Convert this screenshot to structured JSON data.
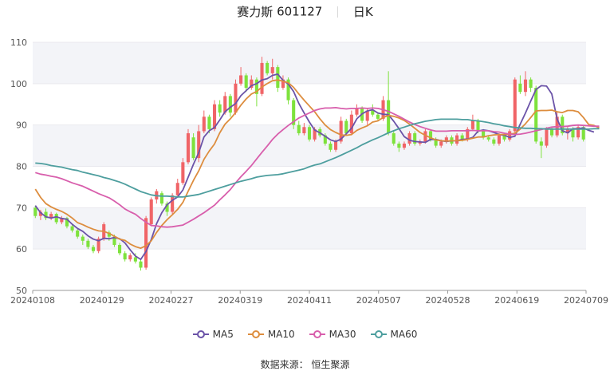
{
  "header": {
    "stock_name": "赛力斯",
    "stock_code": "601127",
    "period": "日K"
  },
  "source": {
    "label": "数据来源：",
    "value": "恒生聚源"
  },
  "colors": {
    "up": "#f06467",
    "down": "#7ee23c",
    "MA5": "#6b53a8",
    "MA10": "#dd8d3e",
    "MA30": "#d85eac",
    "MA60": "#4d9e9e"
  },
  "chart_data": {
    "type": "candlestick",
    "ylim": [
      50,
      110
    ],
    "yticks": [
      50,
      60,
      70,
      80,
      90,
      100,
      110
    ],
    "xticks": [
      "20240108",
      "20240129",
      "20240227",
      "20240319",
      "20240411",
      "20240507",
      "20240528",
      "20240619",
      "20240709"
    ],
    "grid": "banded-horizontal",
    "legend_position": "bottom-center",
    "candles": [
      [
        70.0,
        68.0,
        70.5,
        67.5
      ],
      [
        68.0,
        69.0,
        69.5,
        67.0
      ],
      [
        69.0,
        67.5,
        69.8,
        67.0
      ],
      [
        67.5,
        68.5,
        69.0,
        67.0
      ],
      [
        68.5,
        66.5,
        68.8,
        66.0
      ],
      [
        66.5,
        67.5,
        68.0,
        66.0
      ],
      [
        67.5,
        65.5,
        67.8,
        65.0
      ],
      [
        65.5,
        64.5,
        66.0,
        64.0
      ],
      [
        64.5,
        63.0,
        65.0,
        62.5
      ],
      [
        63.0,
        62.0,
        63.5,
        61.0
      ],
      [
        62.0,
        60.5,
        62.5,
        60.0
      ],
      [
        60.5,
        59.5,
        61.0,
        59.0
      ],
      [
        59.5,
        62.5,
        63.0,
        59.0
      ],
      [
        62.5,
        66.0,
        66.5,
        62.0
      ],
      [
        64.0,
        63.0,
        64.5,
        62.0
      ],
      [
        63.0,
        61.0,
        63.5,
        60.5
      ],
      [
        61.0,
        59.0,
        61.5,
        58.5
      ],
      [
        59.0,
        57.5,
        59.5,
        57.0
      ],
      [
        57.5,
        58.5,
        59.0,
        57.0
      ],
      [
        58.0,
        57.0,
        59.0,
        56.5
      ],
      [
        57.0,
        55.5,
        57.5,
        54.8
      ],
      [
        55.5,
        67.5,
        68.0,
        55.0
      ],
      [
        66.0,
        72.0,
        72.5,
        65.5
      ],
      [
        72.0,
        74.0,
        74.5,
        71.0
      ],
      [
        73.5,
        71.0,
        74.0,
        70.5
      ],
      [
        71.0,
        69.0,
        71.5,
        68.0
      ],
      [
        69.0,
        73.0,
        73.5,
        68.5
      ],
      [
        73.0,
        76.0,
        77.0,
        72.5
      ],
      [
        76.0,
        81.0,
        82.0,
        75.5
      ],
      [
        81.0,
        88.0,
        89.0,
        80.5
      ],
      [
        87.0,
        82.0,
        88.0,
        81.5
      ],
      [
        82.0,
        88.5,
        90.0,
        81.0
      ],
      [
        88.5,
        92.0,
        93.5,
        88.0
      ],
      [
        92.0,
        89.0,
        92.5,
        88.0
      ],
      [
        89.0,
        95.0,
        96.0,
        88.5
      ],
      [
        95.0,
        93.0,
        96.0,
        92.0
      ],
      [
        93.0,
        97.0,
        98.0,
        92.5
      ],
      [
        97.0,
        93.0,
        97.5,
        92.0
      ],
      [
        93.0,
        100.0,
        101.0,
        92.5
      ],
      [
        100.0,
        102.0,
        104.0,
        99.5
      ],
      [
        102.0,
        99.0,
        102.5,
        98.0
      ],
      [
        99.0,
        101.0,
        102.0,
        98.5
      ],
      [
        101.0,
        97.5,
        101.5,
        94.5
      ],
      [
        97.5,
        105.0,
        106.5,
        97.0
      ],
      [
        105.0,
        102.5,
        105.5,
        102.0
      ],
      [
        102.5,
        104.0,
        106.0,
        101.0
      ],
      [
        104.0,
        99.0,
        104.5,
        98.0
      ],
      [
        99.0,
        101.0,
        102.0,
        98.5
      ],
      [
        101.0,
        96.0,
        101.5,
        95.0
      ],
      [
        96.0,
        90.0,
        96.5,
        89.0
      ],
      [
        90.0,
        88.0,
        91.0,
        87.5
      ],
      [
        88.0,
        89.5,
        90.5,
        87.5
      ],
      [
        89.5,
        86.5,
        90.0,
        86.0
      ],
      [
        86.5,
        89.0,
        89.5,
        86.0
      ],
      [
        89.0,
        87.5,
        89.5,
        87.0
      ],
      [
        87.5,
        85.5,
        88.0,
        85.0
      ],
      [
        85.5,
        84.0,
        86.0,
        83.5
      ],
      [
        84.0,
        86.0,
        86.5,
        83.5
      ],
      [
        86.0,
        91.0,
        92.0,
        85.5
      ],
      [
        91.0,
        88.0,
        91.5,
        87.5
      ],
      [
        88.0,
        92.5,
        93.5,
        87.5
      ],
      [
        92.5,
        94.0,
        95.0,
        92.0
      ],
      [
        94.0,
        91.0,
        94.5,
        90.5
      ],
      [
        91.0,
        93.5,
        94.0,
        90.0
      ],
      [
        93.5,
        92.5,
        95.0,
        92.0
      ],
      [
        92.5,
        91.5,
        93.0,
        91.0
      ],
      [
        91.5,
        96.0,
        97.0,
        91.0
      ],
      [
        96.0,
        88.0,
        103.0,
        87.5
      ],
      [
        88.0,
        85.5,
        88.5,
        85.0
      ],
      [
        85.5,
        84.5,
        86.0,
        83.5
      ],
      [
        84.5,
        85.5,
        86.0,
        84.0
      ],
      [
        85.5,
        88.0,
        88.5,
        85.0
      ],
      [
        88.0,
        85.5,
        88.5,
        85.0
      ],
      [
        85.5,
        86.0,
        86.5,
        85.0
      ],
      [
        86.0,
        88.5,
        89.0,
        85.5
      ],
      [
        88.5,
        86.5,
        89.0,
        86.0
      ],
      [
        86.5,
        85.0,
        87.0,
        84.5
      ],
      [
        85.0,
        86.0,
        86.5,
        84.5
      ],
      [
        86.0,
        87.0,
        87.5,
        85.5
      ],
      [
        87.0,
        85.5,
        87.5,
        85.0
      ],
      [
        85.5,
        87.5,
        88.0,
        85.0
      ],
      [
        87.5,
        86.5,
        88.0,
        86.0
      ],
      [
        86.5,
        89.0,
        89.5,
        86.0
      ],
      [
        89.0,
        91.0,
        92.5,
        88.5
      ],
      [
        91.0,
        88.5,
        91.5,
        88.0
      ],
      [
        88.5,
        87.0,
        89.0,
        86.5
      ],
      [
        87.0,
        86.5,
        87.5,
        86.0
      ],
      [
        86.5,
        85.5,
        87.0,
        85.0
      ],
      [
        85.5,
        87.5,
        88.0,
        85.0
      ],
      [
        87.5,
        86.5,
        88.0,
        86.0
      ],
      [
        86.5,
        88.5,
        89.0,
        86.0
      ],
      [
        88.5,
        101.0,
        101.5,
        88.0
      ],
      [
        100.0,
        98.0,
        102.0,
        97.5
      ],
      [
        98.0,
        101.0,
        103.0,
        97.0
      ],
      [
        101.0,
        99.0,
        101.5,
        98.0
      ],
      [
        99.0,
        86.0,
        99.5,
        85.5
      ],
      [
        86.0,
        85.0,
        87.0,
        82.0
      ],
      [
        85.0,
        89.0,
        89.5,
        84.5
      ],
      [
        89.0,
        87.5,
        89.5,
        87.0
      ],
      [
        87.5,
        92.0,
        93.0,
        87.0
      ],
      [
        92.0,
        88.0,
        92.5,
        87.5
      ],
      [
        88.0,
        89.0,
        89.5,
        86.5
      ],
      [
        89.0,
        87.0,
        89.5,
        86.0
      ],
      [
        87.0,
        89.5,
        90.0,
        86.5
      ],
      [
        89.5,
        86.5,
        90.0,
        86.0
      ]
    ],
    "moving_averages": [
      {
        "name": "MA5",
        "start": 0,
        "values": [
          70.5,
          68.8,
          67.8,
          67.5,
          67.8,
          67.4,
          67.2,
          66.0,
          65.0,
          64.3,
          63.2,
          62.4,
          62.0,
          62.6,
          62.5,
          62.8,
          62.5,
          61.5,
          59.8,
          58.3,
          57.5,
          59.4,
          62.3,
          66.1,
          68.8,
          70.7,
          71.8,
          72.6,
          74.3,
          77.4,
          80.5,
          83.3,
          87.1,
          88.6,
          89.4,
          91.2,
          93.2,
          94.3,
          95.2,
          97.1,
          98.3,
          99.5,
          100.0,
          100.9,
          101.2,
          102.0,
          102.3,
          100.8,
          99.9,
          98.1,
          95.2,
          92.9,
          90.7,
          88.8,
          88.1,
          87.3,
          86.4,
          86.0,
          86.6,
          87.9,
          89.2,
          91.5,
          92.7,
          93.4,
          93.7,
          92.9,
          92.6,
          92.5,
          90.9,
          89.1,
          87.2,
          86.3,
          86.0,
          85.9,
          85.8,
          86.5,
          86.5,
          86.2,
          86.0,
          86.2,
          86.2,
          86.5,
          86.6,
          87.0,
          88.5,
          88.8,
          88.6,
          88.2,
          87.7,
          87.5,
          87.0,
          87.3,
          90.2,
          92.9,
          95.8,
          98.6,
          99.5,
          99.4,
          97.5,
          91.5,
          88.6,
          88.1,
          89.1,
          89.1,
          89.3,
          88.7,
          88.3
        ]
      },
      {
        "name": "MA10",
        "start": 0,
        "values": [
          74.5,
          72.5,
          71.0,
          70.2,
          69.6,
          69.1,
          68.4,
          67.5,
          66.4,
          65.9,
          65.3,
          64.8,
          64.4,
          64.3,
          63.8,
          63.1,
          62.4,
          62.1,
          61.2,
          60.6,
          60.2,
          60.8,
          62.0,
          64.0,
          65.7,
          67.1,
          68.3,
          69.6,
          71.3,
          74.0,
          76.6,
          78.9,
          81.7,
          83.7,
          85.4,
          88.1,
          90.2,
          91.5,
          93.0,
          94.8,
          96.3,
          97.5,
          98.1,
          99.2,
          100.0,
          100.7,
          100.9,
          100.6,
          100.2,
          99.1,
          97.5,
          96.0,
          94.6,
          93.2,
          91.5,
          90.0,
          88.9,
          88.2,
          87.6,
          87.5,
          87.7,
          88.7,
          89.3,
          89.8,
          90.7,
          91.0,
          91.8,
          92.3,
          92.1,
          91.7,
          91.1,
          90.2,
          89.2,
          88.2,
          87.5,
          86.9,
          86.4,
          86.2,
          86.1,
          86.2,
          86.2,
          86.3,
          86.5,
          86.8,
          87.1,
          87.1,
          87.4,
          87.6,
          87.7,
          87.7,
          87.8,
          88.0,
          89.0,
          90.3,
          91.8,
          93.4,
          93.5,
          93.5,
          93.6,
          93.2,
          93.0,
          93.5,
          93.5,
          93.2,
          91.8,
          90.1,
          89.9,
          89.3
        ]
      },
      {
        "name": "MA30",
        "start": 0,
        "values": [
          78.5,
          78.1,
          77.9,
          77.6,
          77.4,
          77.0,
          76.5,
          76.0,
          75.6,
          75.2,
          74.6,
          74.0,
          73.4,
          72.9,
          72.4,
          71.6,
          70.7,
          69.7,
          69.0,
          68.4,
          67.4,
          66.5,
          65.7,
          65.6,
          65.4,
          65.3,
          65.4,
          65.6,
          65.8,
          66.5,
          67.2,
          68.0,
          68.8,
          69.7,
          70.6,
          71.9,
          73.1,
          74.4,
          76.0,
          77.5,
          78.8,
          80.2,
          81.8,
          83.4,
          84.9,
          86.5,
          87.8,
          88.9,
          89.9,
          90.8,
          91.7,
          92.3,
          92.9,
          93.5,
          93.9,
          94.1,
          94.1,
          94.2,
          94.0,
          93.9,
          94.0,
          94.0,
          94.1,
          94.0,
          94.1,
          94.0,
          93.7,
          93.3,
          92.7,
          92.1,
          91.4,
          90.7,
          90.1,
          89.6,
          89.2,
          88.8,
          88.5,
          88.5,
          88.5,
          88.6,
          88.6,
          88.6,
          88.6,
          88.7,
          88.6,
          88.6,
          88.6,
          88.4,
          88.3,
          88.0,
          87.8,
          87.7,
          87.8,
          88.0,
          88.3,
          88.6,
          88.9,
          89.2,
          89.5,
          89.6,
          89.6,
          89.7,
          89.9,
          90.0,
          89.9,
          89.8,
          89.7,
          89.7
        ]
      },
      {
        "name": "MA60",
        "start": 0,
        "values": [
          80.8,
          80.7,
          80.5,
          80.2,
          80.0,
          79.8,
          79.5,
          79.2,
          79.0,
          78.6,
          78.3,
          78.0,
          77.7,
          77.3,
          77.0,
          76.6,
          76.2,
          75.7,
          75.1,
          74.5,
          73.9,
          73.5,
          73.1,
          72.9,
          72.8,
          72.8,
          72.7,
          72.6,
          72.6,
          72.8,
          73.0,
          73.2,
          73.6,
          74.0,
          74.4,
          74.8,
          75.2,
          75.6,
          76.0,
          76.4,
          76.7,
          77.0,
          77.4,
          77.6,
          77.8,
          77.9,
          78.0,
          78.2,
          78.5,
          78.8,
          79.1,
          79.4,
          79.9,
          80.3,
          80.6,
          81.1,
          81.6,
          82.1,
          82.7,
          83.3,
          83.9,
          84.5,
          85.2,
          85.8,
          86.4,
          86.9,
          87.5,
          88.1,
          88.6,
          89.1,
          89.5,
          89.9,
          90.3,
          90.6,
          90.9,
          91.1,
          91.3,
          91.4,
          91.4,
          91.4,
          91.4,
          91.3,
          91.3,
          91.1,
          91.0,
          90.8,
          90.6,
          90.3,
          90.1,
          89.8,
          89.6,
          89.4,
          89.3,
          89.2,
          89.2,
          89.1,
          89.1,
          89.0,
          89.0,
          89.0,
          89.0,
          89.0,
          89.0,
          89.0,
          89.0,
          89.0,
          89.1,
          89.1
        ]
      }
    ]
  }
}
